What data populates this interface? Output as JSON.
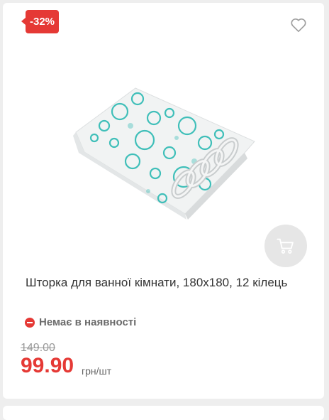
{
  "product": {
    "discount_badge": "-32%",
    "title": "Шторка для ванної кімнати, 180х180, 12 кілець",
    "stock_status": "Немає в наявності",
    "old_price": "149.00",
    "price": "99.90",
    "price_unit": "грн/шт"
  },
  "icons": {
    "favorite": "heart-outline-icon",
    "cart": "cart-icon",
    "stock": "minus-circle-icon"
  },
  "colors": {
    "accent": "#e53935",
    "cart_button_bg": "#e6e6e6",
    "text": "#333333",
    "muted": "#999999"
  }
}
